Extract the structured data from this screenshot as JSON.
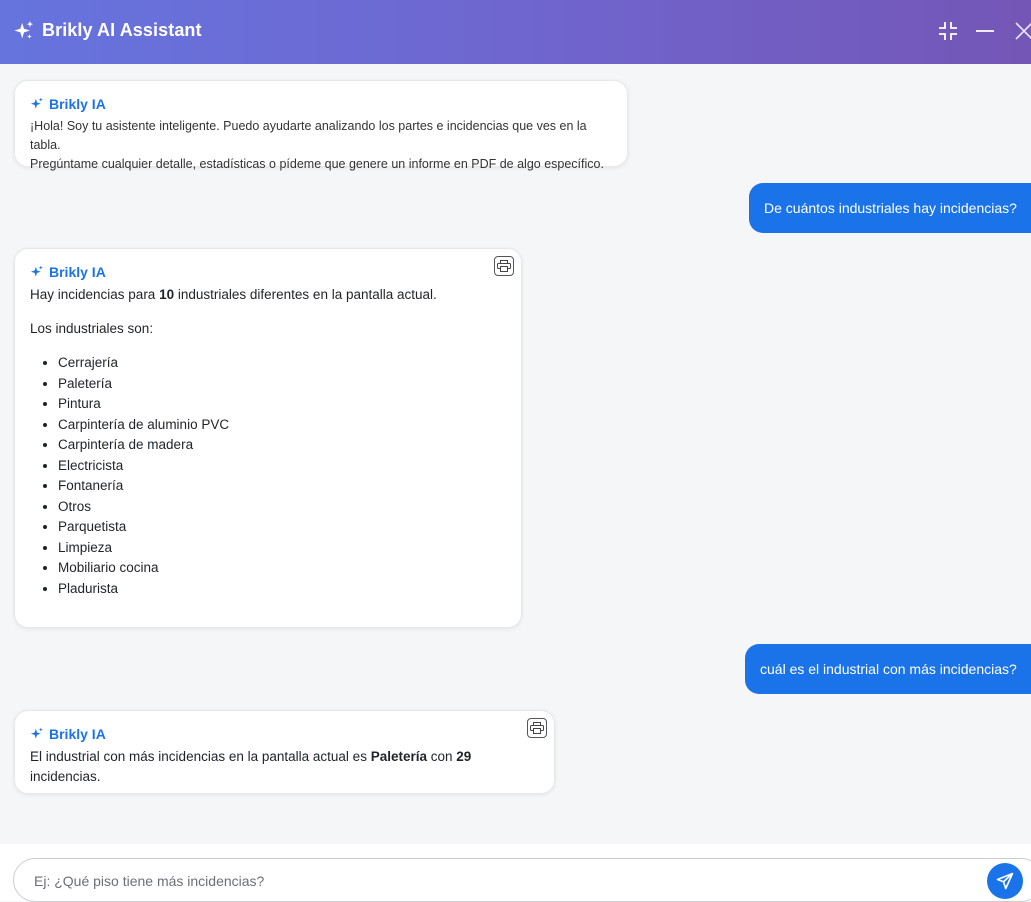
{
  "header": {
    "title": "Brikly AI Assistant",
    "icons": [
      "sparkle-icon",
      "collapse-icon",
      "minimize-icon",
      "close-icon"
    ]
  },
  "colors": {
    "accent": "#1a73e8",
    "header_start": "#6674de",
    "header_end": "#7456b6"
  },
  "messages": [
    {
      "role": "bot",
      "name": "Brikly IA",
      "text_1": "¡Hola! Soy tu asistente inteligente. Puedo ayudarte analizando los partes e incidencias que ves en la tabla.",
      "text_2": "Pregúntame cualquier detalle, estadísticas o pídeme que genere un informe en PDF de algo específico."
    },
    {
      "role": "user",
      "text": "De cuántos industriales hay incidencias?"
    },
    {
      "role": "bot",
      "name": "Brikly IA",
      "line_pre": "Hay incidencias para ",
      "line_num": "10",
      "line_post": " industriales diferentes en la pantalla actual.",
      "list_intro": "Los industriales son:",
      "items": [
        "Cerrajería",
        "Paletería",
        "Pintura",
        "Carpintería de aluminio PVC",
        "Carpintería de madera",
        "Electricista",
        "Fontanería",
        "Otros",
        "Parquetista",
        "Limpieza",
        "Mobiliario cocina",
        "Pladurista"
      ]
    },
    {
      "role": "user",
      "text": "cuál es el industrial con más incidencias?"
    },
    {
      "role": "bot",
      "name": "Brikly IA",
      "pre": "El industrial con más incidencias en la pantalla actual es ",
      "bold_name": "Paletería",
      "mid": " con ",
      "bold_num": "29",
      "post": " incidencias."
    }
  ],
  "composer": {
    "placeholder": "Ej: ¿Qué piso tiene más incidencias?",
    "value": ""
  }
}
